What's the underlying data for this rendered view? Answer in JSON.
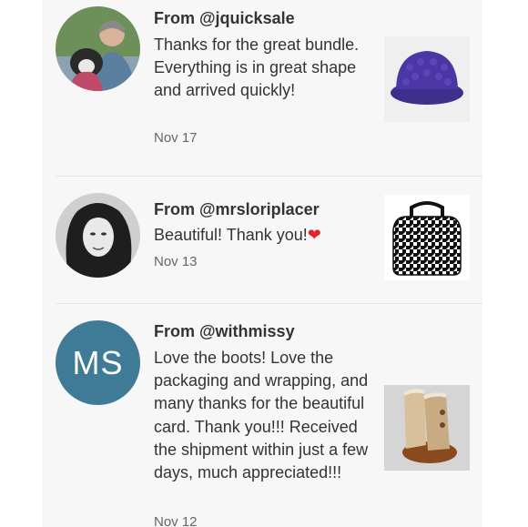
{
  "reviews": [
    {
      "from": "From @jquicksale",
      "message": "Thanks for the great bundle. Everything is in great shape and arrived quickly!",
      "date": "Nov 17",
      "avatar": "photo-woman-with-dog",
      "item": "purple-knit-hat"
    },
    {
      "from": "From @mrsloriplacer",
      "message": "Beautiful! Thank you!",
      "message_emoji": "❤",
      "date": "Nov 13",
      "avatar": "photo-woman-bw",
      "item": "houndstooth-lunch-bag"
    },
    {
      "from": "From @withmissy",
      "message": "Love the boots! Love the packaging and wrapping, and many thanks for the beautiful card. Thank you!!! Received the shipment within just a few days, much appreciated!!!",
      "date": "Nov 12",
      "avatar_initials": "MS",
      "avatar_color": "#3f7b96",
      "item": "tan-sheepskin-boots"
    }
  ]
}
